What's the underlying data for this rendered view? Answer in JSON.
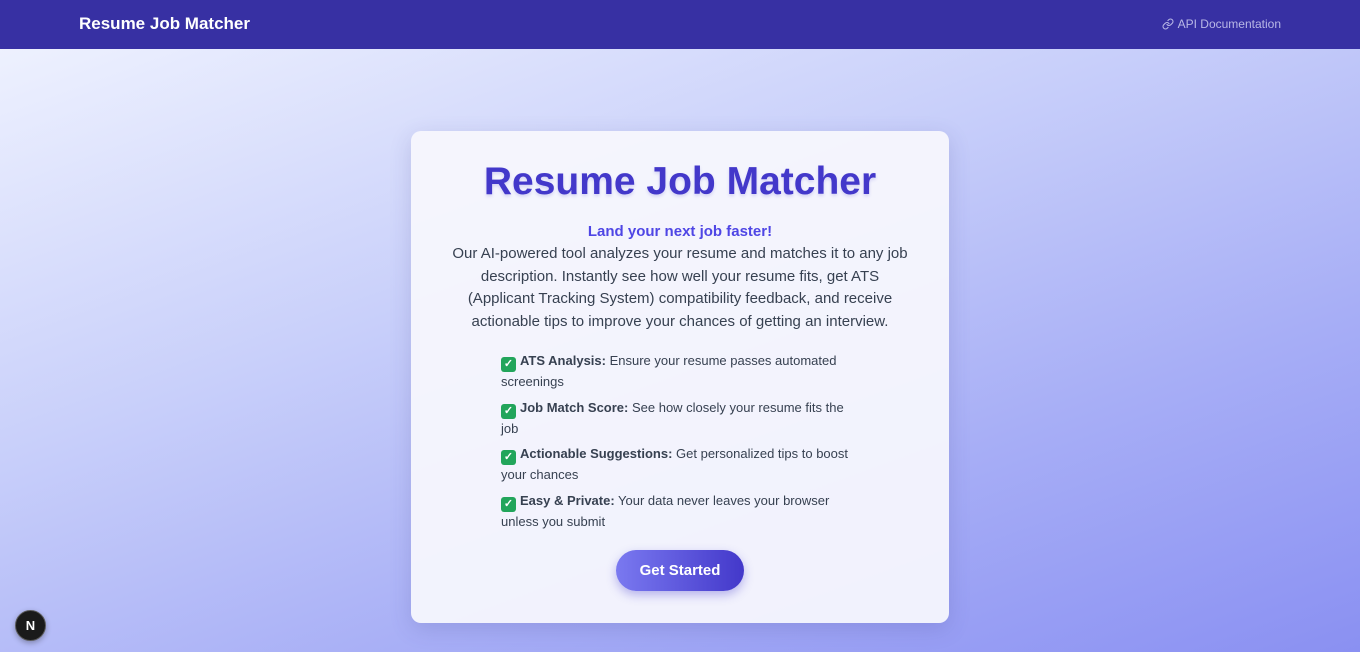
{
  "navbar": {
    "brand": "Resume Job Matcher",
    "api_link_label": "API Documentation",
    "api_link_icon": "link-icon"
  },
  "hero": {
    "title": "Resume Job Matcher",
    "tagline": "Land your next job faster!",
    "description": "Our AI-powered tool analyzes your resume and matches it to any job description. Instantly see how well your resume fits, get ATS (Applicant Tracking System) compatibility feedback, and receive actionable tips to improve your chances of getting an interview.",
    "features": [
      {
        "icon": "checkmark-icon",
        "title": "ATS Analysis:",
        "text": " Ensure your resume passes automated screenings"
      },
      {
        "icon": "checkmark-icon",
        "title": "Job Match Score:",
        "text": " See how closely your resume fits the job"
      },
      {
        "icon": "checkmark-icon",
        "title": "Actionable Suggestions:",
        "text": " Get personalized tips to boost your chances"
      },
      {
        "icon": "checkmark-icon",
        "title": "Easy & Private:",
        "text": " Your data never leaves your browser unless you submit"
      }
    ],
    "cta_label": "Get Started"
  },
  "dev_badge": {
    "label": "N",
    "icon": "nextjs-logo-icon"
  },
  "colors": {
    "navbar": "#3730a3",
    "accent": "#4338ca",
    "tagline": "#4f46e5",
    "check": "#22a55b"
  }
}
